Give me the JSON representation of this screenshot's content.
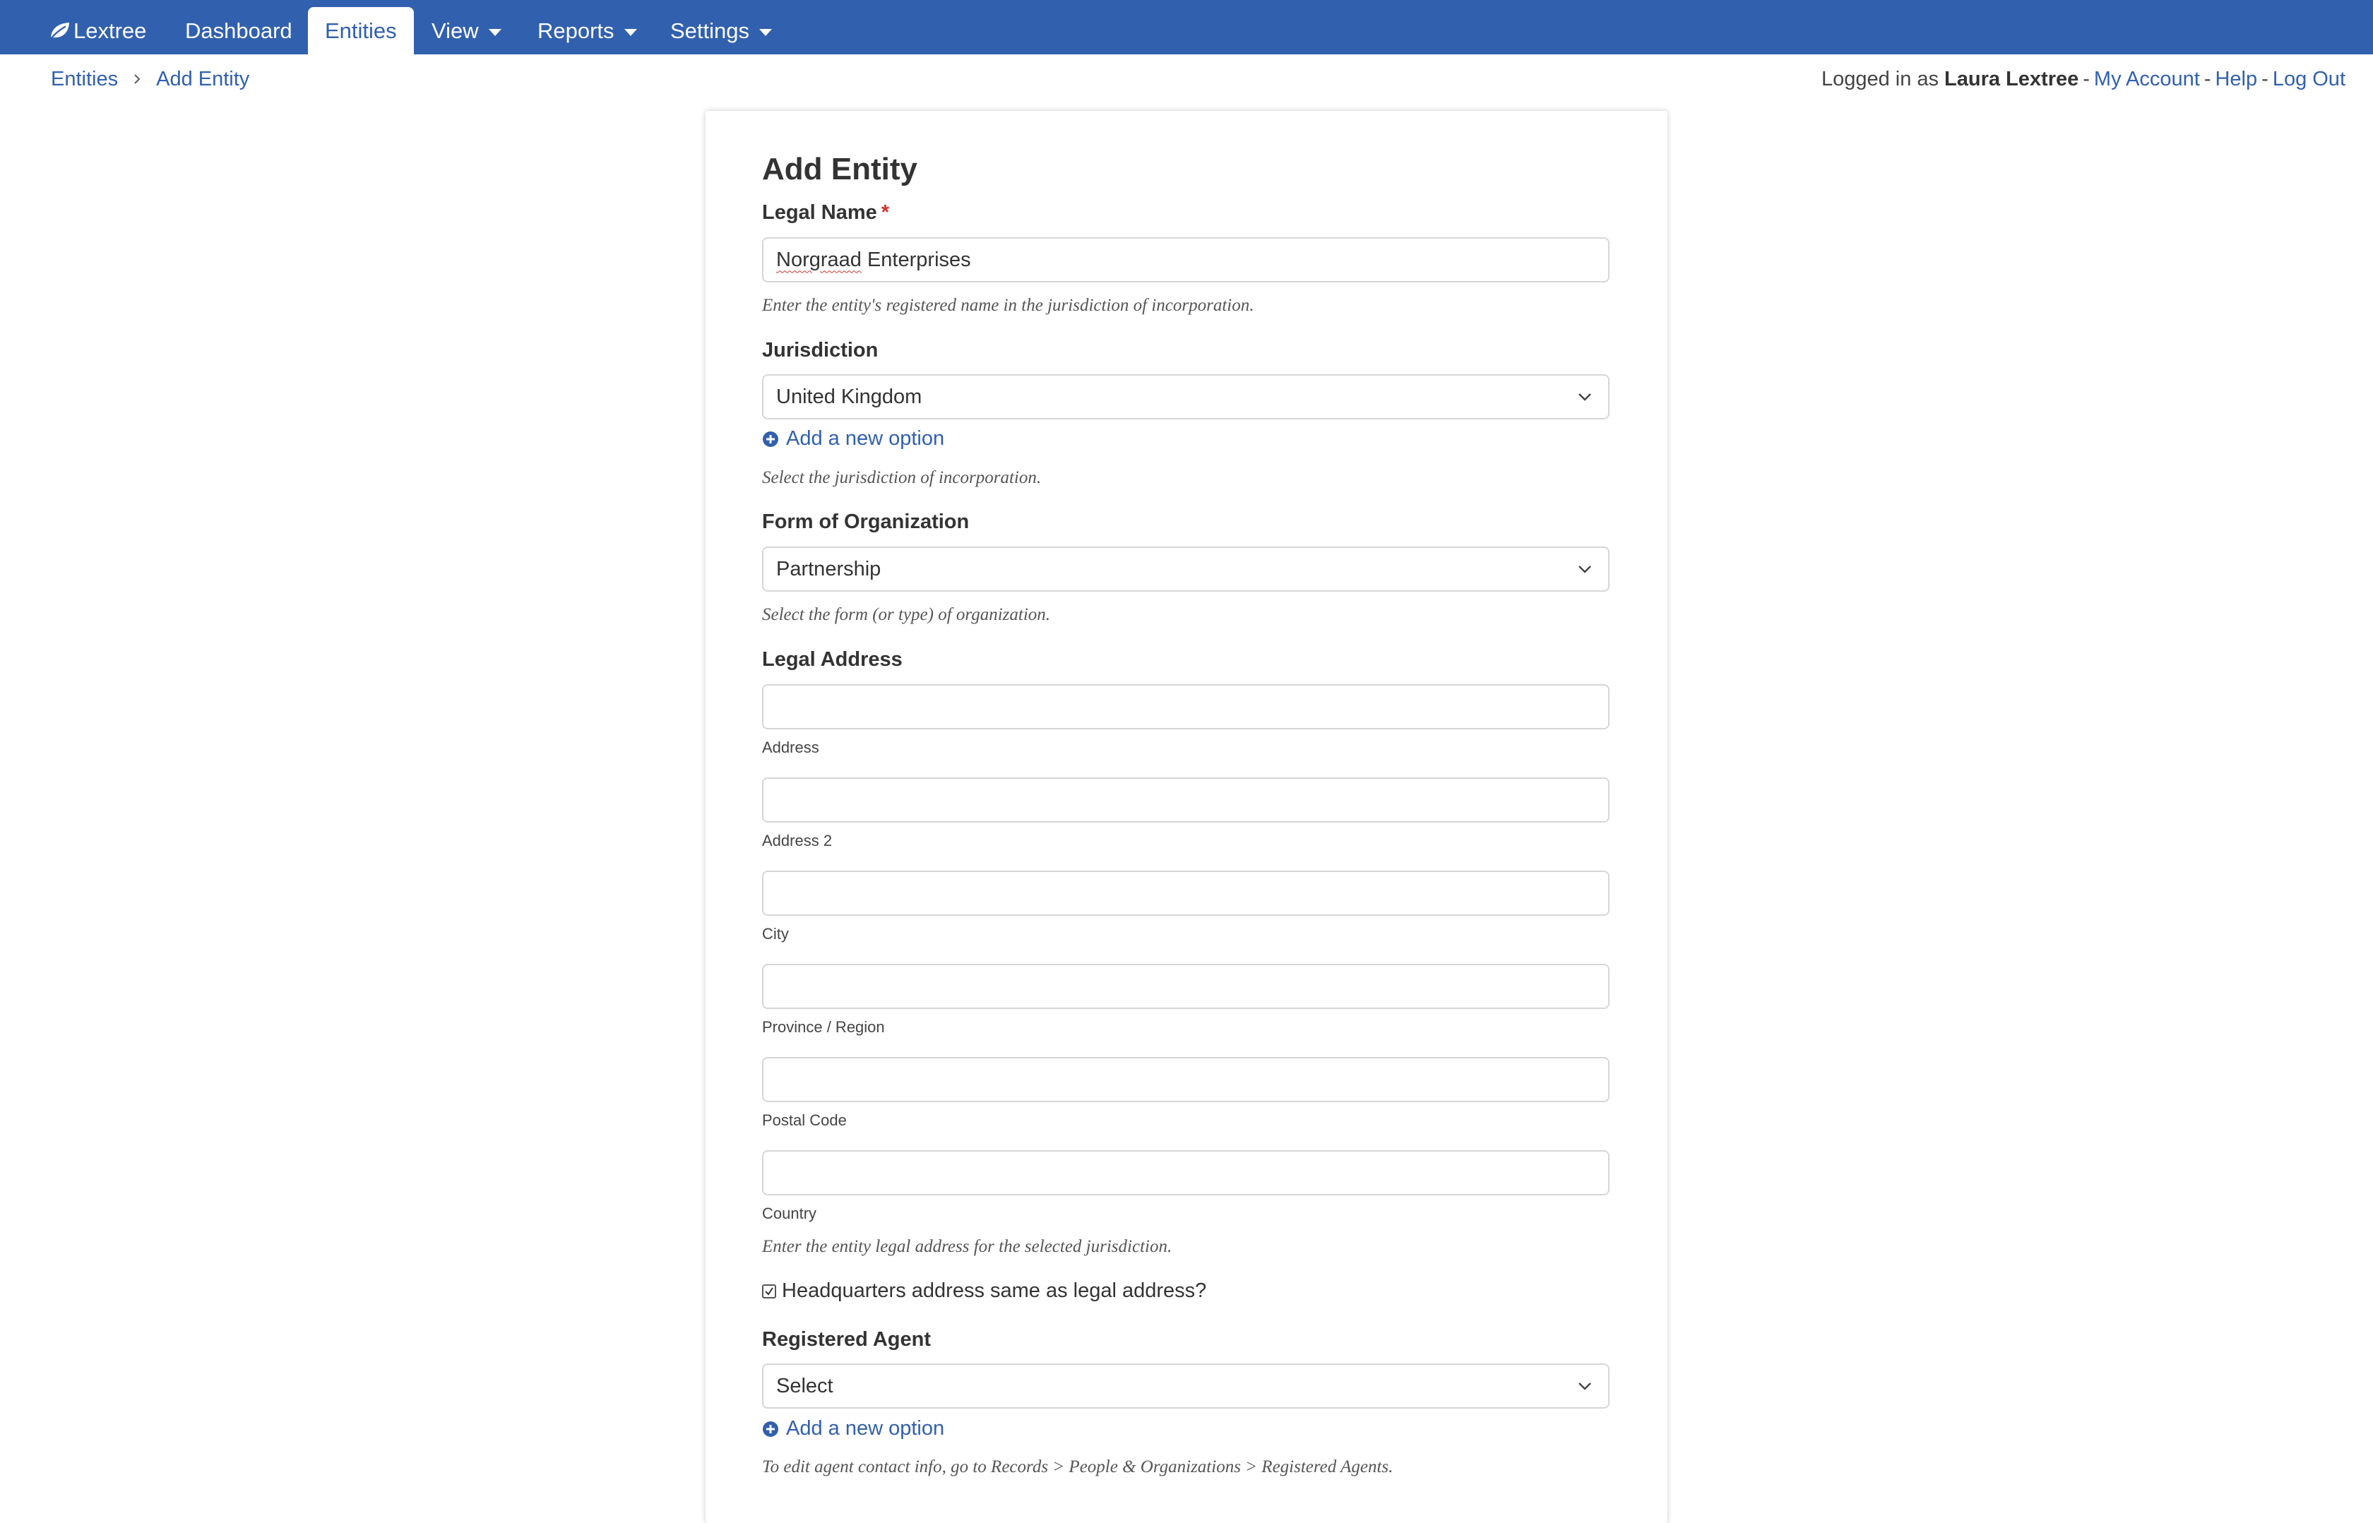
{
  "nav": {
    "brand": "Lextree",
    "items": [
      {
        "label": "Dashboard"
      },
      {
        "label": "Entities"
      },
      {
        "label": "View"
      },
      {
        "label": "Reports"
      },
      {
        "label": "Settings"
      }
    ]
  },
  "breadcrumb": {
    "items": [
      "Entities",
      "Add Entity"
    ]
  },
  "user": {
    "prefix": "Logged in as",
    "name": "Laura Lextree",
    "links": [
      "My Account",
      "Help",
      "Log Out"
    ]
  },
  "form": {
    "title": "Add Entity",
    "legal_name": {
      "label": "Legal Name",
      "required_mark": "*",
      "value_first": "Norgraad",
      "value_rest": " Enterprises",
      "help": "Enter the entity's registered name in the jurisdiction of incorporation."
    },
    "jurisdiction": {
      "label": "Jurisdiction",
      "value": "United Kingdom",
      "add_option": "Add a new option",
      "help": "Select the jurisdiction of incorporation."
    },
    "form_of_org": {
      "label": "Form of Organization",
      "value": "Partnership",
      "help": "Select the form (or type) of organization."
    },
    "legal_address": {
      "label": "Legal Address",
      "fields": [
        {
          "sublabel": "Address",
          "value": ""
        },
        {
          "sublabel": "Address 2",
          "value": ""
        },
        {
          "sublabel": "City",
          "value": ""
        },
        {
          "sublabel": "Province / Region",
          "value": ""
        },
        {
          "sublabel": "Postal Code",
          "value": ""
        },
        {
          "sublabel": "Country",
          "value": ""
        }
      ],
      "help": "Enter the entity legal address for the selected jurisdiction."
    },
    "hq_same": {
      "label": "Headquarters address same as legal address?",
      "checked": true
    },
    "registered_agent": {
      "label": "Registered Agent",
      "value": "Select",
      "add_option": "Add a new option",
      "help": "To edit agent contact info, go to Records > People & Organizations > Registered Agents."
    }
  },
  "colors": {
    "nav_bg": "#3160ae",
    "link": "#3160ae",
    "required": "#d0312d"
  }
}
